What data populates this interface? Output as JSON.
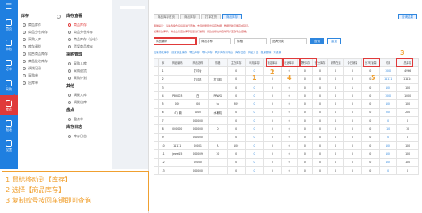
{
  "appbar": {
    "logo": "☰",
    "items": [
      {
        "label": "首页"
      },
      {
        "label": "审核"
      },
      {
        "label": "订单"
      },
      {
        "label": "采购"
      },
      {
        "label": "库存"
      },
      {
        "label": "报表"
      },
      {
        "label": "设置"
      }
    ]
  },
  "submenu": {
    "left_sections": [
      {
        "title": "库存",
        "items": [
          "商品库存",
          "商品分仓库存",
          "采购入库",
          "库存调拨",
          "组合商品库存",
          "商品批次库存",
          "调拨记录",
          "采购单",
          "出库单"
        ]
      }
    ],
    "right_sections": [
      {
        "title": "库存查看",
        "items": [
          "商品库存",
          "商品分仓库存",
          "商品库存（分仓）",
          "货架商品库存"
        ]
      },
      {
        "title": "采购管理",
        "items": [
          "采购入库",
          "采购退货",
          "采购计划"
        ]
      },
      {
        "title": "其他",
        "items": [
          "调拨入库",
          "调拨出库"
        ]
      },
      {
        "title": "盘点",
        "items": [
          "盘点单"
        ]
      },
      {
        "title": "库存日志",
        "items": [
          "库存日志"
        ]
      }
    ],
    "highlighted": "商品库存"
  },
  "main": {
    "tabs": [
      "商品库存首页",
      "商品库存",
      "打单发货",
      "商品库存"
    ],
    "active_tab": 3,
    "top_right_button": "查询结果",
    "tips": [
      "温馨提示：请先选择仓库后再进行查询，支持批量导出库存数据，数据更新可能存在延迟。",
      "如需修改库存，请点击对应的库存数量进行编辑，修改后系统将自动同步至各平台店铺。"
    ],
    "filters": {
      "search_placeholder": "商品编码",
      "f2": "商品名称",
      "f3": "规格",
      "f4": "品牌分类",
      "query": "查询",
      "reset": "重置"
    },
    "toolbar": [
      "批量修改库存",
      "设置安全库存",
      "导出库存",
      "导入库存",
      "同步库存到平台",
      "库存日志",
      "商品分仓",
      "批量删除",
      "列设置"
    ],
    "columns": [
      "",
      "序",
      "商品编码",
      "商品名称",
      "规格",
      "主仓库存",
      "可用库存",
      "锁定库存",
      "在途库存",
      "预警库存",
      "安全库存",
      "采购在途",
      "今日销量",
      "近7天销量",
      "可用",
      "总库存"
    ],
    "rows": [
      [
        "",
        "1",
        "",
        "打印台",
        "",
        "0",
        "0",
        "0",
        "0",
        "0",
        "0",
        "0",
        "0",
        "0",
        "1000",
        "4996"
      ],
      [
        "",
        "2",
        "",
        "打印机",
        "打印机",
        "0",
        "0",
        "0",
        "0",
        "0",
        "0",
        "0",
        "0",
        "0",
        "11111",
        "11114"
      ],
      [
        "",
        "3",
        "",
        "",
        "",
        "0",
        "0",
        "0",
        "0",
        "0",
        "0",
        "0",
        "1",
        "0",
        "100",
        "100"
      ],
      [
        "",
        "4",
        "PBK003",
        "白",
        "PRWG",
        "0",
        "0",
        "0",
        "0",
        "0",
        "0",
        "0",
        "0",
        "0",
        "1000",
        "1000"
      ],
      [
        "",
        "5",
        "000",
        "300",
        "tu",
        "309",
        "0",
        "0",
        "0",
        "0",
        "0",
        "0",
        "0",
        "0",
        "100",
        "100"
      ],
      [
        "",
        "6",
        "（T）款",
        "0000",
        "水桶机",
        "0",
        "0",
        "0",
        "0",
        "0",
        "0",
        "0",
        "0",
        "0",
        "200",
        "200"
      ],
      [
        "",
        "7",
        "",
        "000000",
        "",
        "0",
        "0",
        "0",
        "0",
        "0",
        "0",
        "0",
        "0",
        "0",
        "0",
        "0"
      ],
      [
        "",
        "8",
        "000000",
        "000000",
        "D",
        "0",
        "0",
        "0",
        "0",
        "0",
        "0",
        "0",
        "0",
        "0",
        "10",
        "10"
      ],
      [
        "",
        "9",
        "",
        "000000",
        "",
        "0",
        "0",
        "0",
        "0",
        "0",
        "0",
        "0",
        "0",
        "0",
        "0",
        "0"
      ],
      [
        "",
        "10",
        "11111",
        "00001",
        "A",
        "100",
        "0",
        "0",
        "0",
        "0",
        "0",
        "0",
        "0",
        "0",
        "100",
        "100"
      ],
      [
        "",
        "11",
        "jewel15",
        "000009",
        "10",
        "0",
        "0",
        "0",
        "0",
        "0",
        "0",
        "0",
        "0",
        "0",
        "100",
        "100"
      ],
      [
        "",
        "12",
        "",
        "00000",
        "",
        "0",
        "0",
        "0",
        "0",
        "0",
        "0",
        "0",
        "0",
        "0",
        "100",
        "100"
      ],
      [
        "",
        "13",
        "",
        "000000",
        "",
        "0",
        "0",
        "0",
        "0",
        "0",
        "0",
        "0",
        "0",
        "0",
        "0",
        "0"
      ]
    ],
    "markers": [
      "1",
      "2",
      "3",
      "4",
      "5"
    ]
  },
  "note": {
    "lines": [
      "1.鼠标移动到【库存】",
      "2.选择【商品库存】",
      "3.复制款号按回车键即可查询"
    ]
  }
}
